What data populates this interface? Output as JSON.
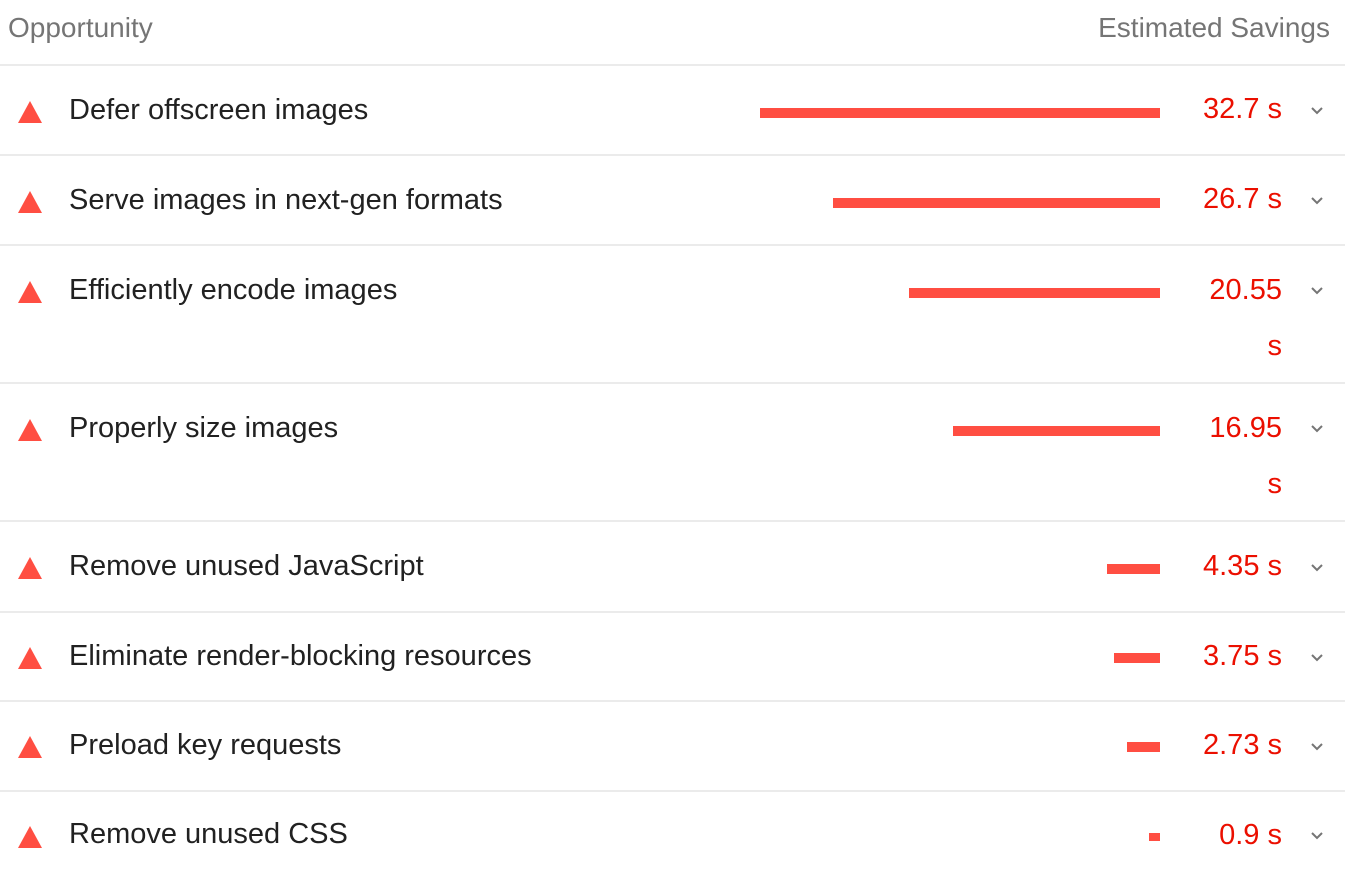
{
  "header": {
    "opportunity_label": "Opportunity",
    "savings_label": "Estimated Savings"
  },
  "colors": {
    "fail_red": "#ff4e42",
    "savings_text": "#eb0f00",
    "divider": "#ebebeb"
  },
  "opportunities": [
    {
      "title": "Defer offscreen images",
      "savings_line1": "32.7 s",
      "savings_line2": "",
      "savings_seconds": 32.7,
      "icon": "fail-triangle-icon"
    },
    {
      "title": "Serve images in next-gen formats",
      "savings_line1": "26.7 s",
      "savings_line2": "",
      "savings_seconds": 26.7,
      "icon": "fail-triangle-icon"
    },
    {
      "title": "Efficiently encode images",
      "savings_line1": "20.55",
      "savings_line2": "s",
      "savings_seconds": 20.55,
      "icon": "fail-triangle-icon"
    },
    {
      "title": "Properly size images",
      "savings_line1": "16.95",
      "savings_line2": "s",
      "savings_seconds": 16.95,
      "icon": "fail-triangle-icon"
    },
    {
      "title": "Remove unused JavaScript",
      "savings_line1": "4.35 s",
      "savings_line2": "",
      "savings_seconds": 4.35,
      "icon": "fail-triangle-icon"
    },
    {
      "title": "Eliminate render-blocking resources",
      "savings_line1": "3.75 s",
      "savings_line2": "",
      "savings_seconds": 3.75,
      "icon": "fail-triangle-icon"
    },
    {
      "title": "Preload key requests",
      "savings_line1": "2.73 s",
      "savings_line2": "",
      "savings_seconds": 2.73,
      "icon": "fail-triangle-icon"
    },
    {
      "title": "Remove unused CSS",
      "savings_line1": "0.9 s",
      "savings_line2": "",
      "savings_seconds": 0.9,
      "icon": "fail-triangle-icon"
    }
  ]
}
